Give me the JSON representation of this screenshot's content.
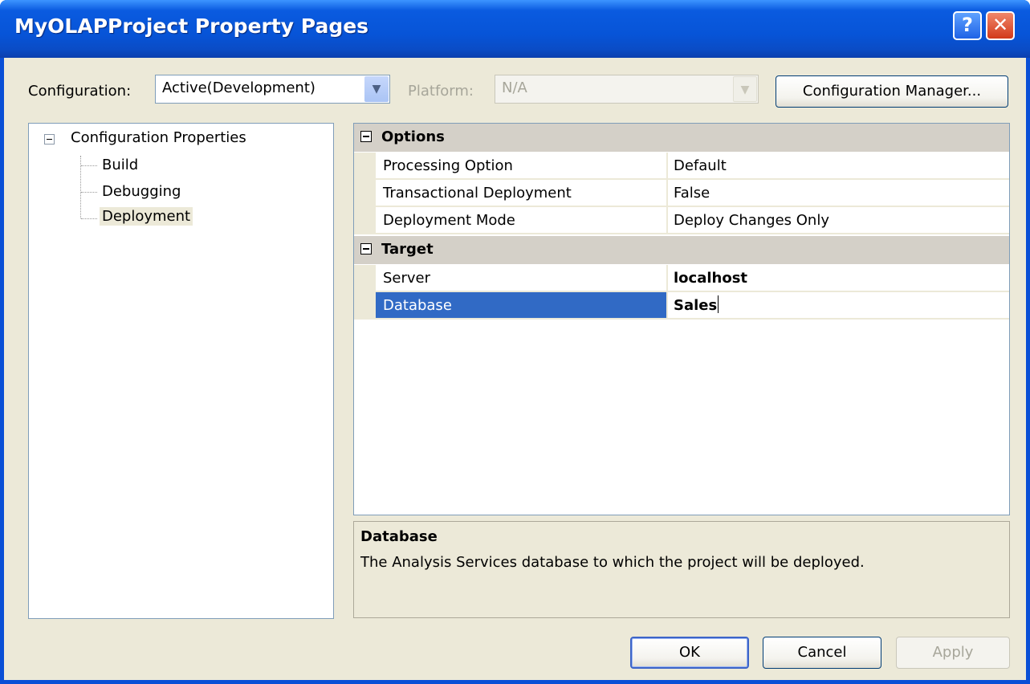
{
  "window": {
    "title": "MyOLAPProject Property Pages"
  },
  "titlebar": {
    "help_glyph": "?",
    "close_glyph": "✕"
  },
  "toolbar": {
    "configuration_label": "Configuration:",
    "configuration_value": "Active(Development)",
    "platform_label": "Platform:",
    "platform_value": "N/A",
    "config_manager_label": "Configuration Manager..."
  },
  "tree": {
    "root": "Configuration Properties",
    "items": [
      {
        "label": "Build",
        "selected": false
      },
      {
        "label": "Debugging",
        "selected": false
      },
      {
        "label": "Deployment",
        "selected": true
      }
    ]
  },
  "grid": {
    "categories": [
      {
        "name": "Options",
        "properties": [
          {
            "name": "Processing Option",
            "value": "Default"
          },
          {
            "name": "Transactional Deployment",
            "value": "False"
          },
          {
            "name": "Deployment Mode",
            "value": "Deploy Changes Only"
          }
        ]
      },
      {
        "name": "Target",
        "properties": [
          {
            "name": "Server",
            "value": "localhost"
          },
          {
            "name": "Database",
            "value": "Sales"
          }
        ]
      }
    ]
  },
  "description": {
    "title": "Database",
    "text": "The Analysis Services database to which the project will be deployed."
  },
  "buttons": {
    "ok": "OK",
    "cancel": "Cancel",
    "apply": "Apply"
  },
  "colors": {
    "titlebar": "#0754d7",
    "selection": "#316ac5",
    "dialog_bg": "#ece9d8"
  },
  "icons": {
    "dropdown": "chevron-down-icon",
    "help": "help-icon",
    "close": "close-icon"
  }
}
